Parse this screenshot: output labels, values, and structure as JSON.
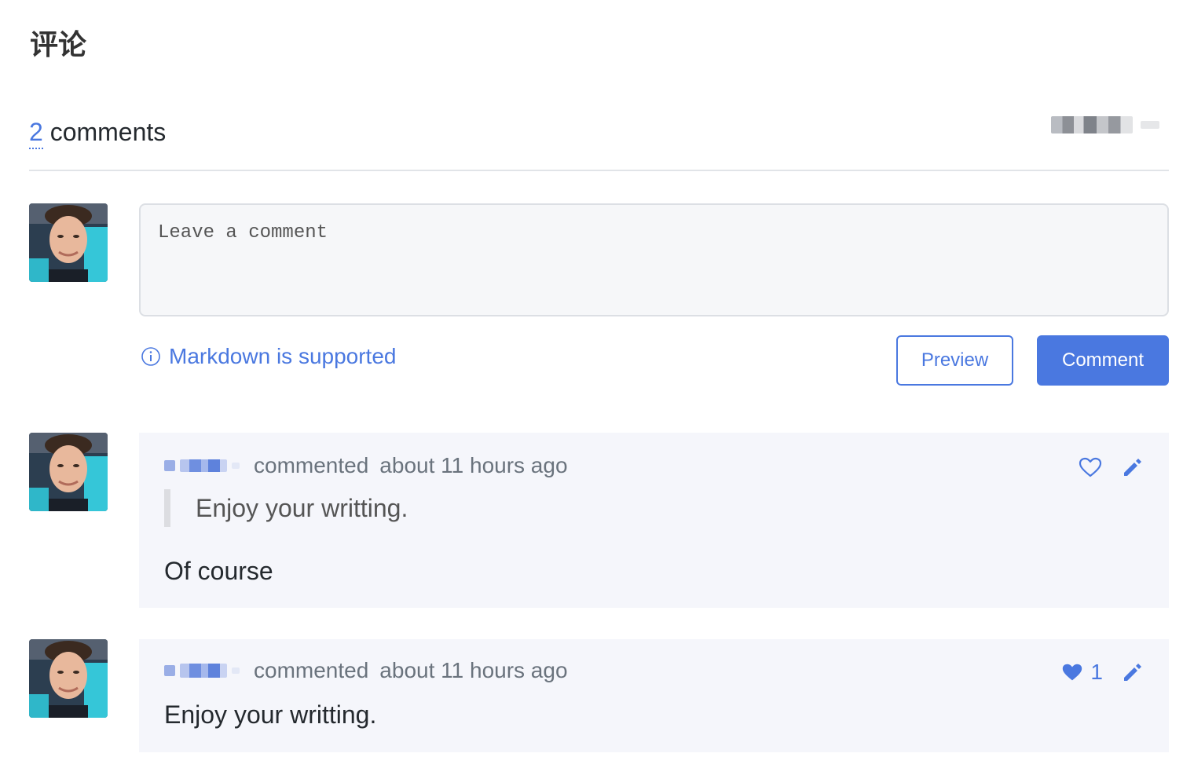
{
  "page_title": "评论",
  "comments_header": {
    "count": "2",
    "label": "comments"
  },
  "composer": {
    "placeholder": "Leave a comment",
    "markdown_hint": "Markdown is supported",
    "preview_label": "Preview",
    "submit_label": "Comment"
  },
  "comments": [
    {
      "action": "commented",
      "time": "about 11 hours ago",
      "quote": "Enjoy your writting.",
      "body": "Of course",
      "liked": false,
      "like_count": ""
    },
    {
      "action": "commented",
      "time": "about 11 hours ago",
      "quote": "",
      "body": "Enjoy your writting.",
      "liked": true,
      "like_count": "1"
    }
  ],
  "colors": {
    "accent": "#4a78e0",
    "card_bg": "#f5f6fb",
    "text": "#24292e",
    "muted": "#6a737d"
  },
  "icons": {
    "info": "info-circle-icon",
    "like_empty": "heart-outline-icon",
    "like_filled": "heart-filled-icon",
    "edit": "pencil-icon"
  }
}
